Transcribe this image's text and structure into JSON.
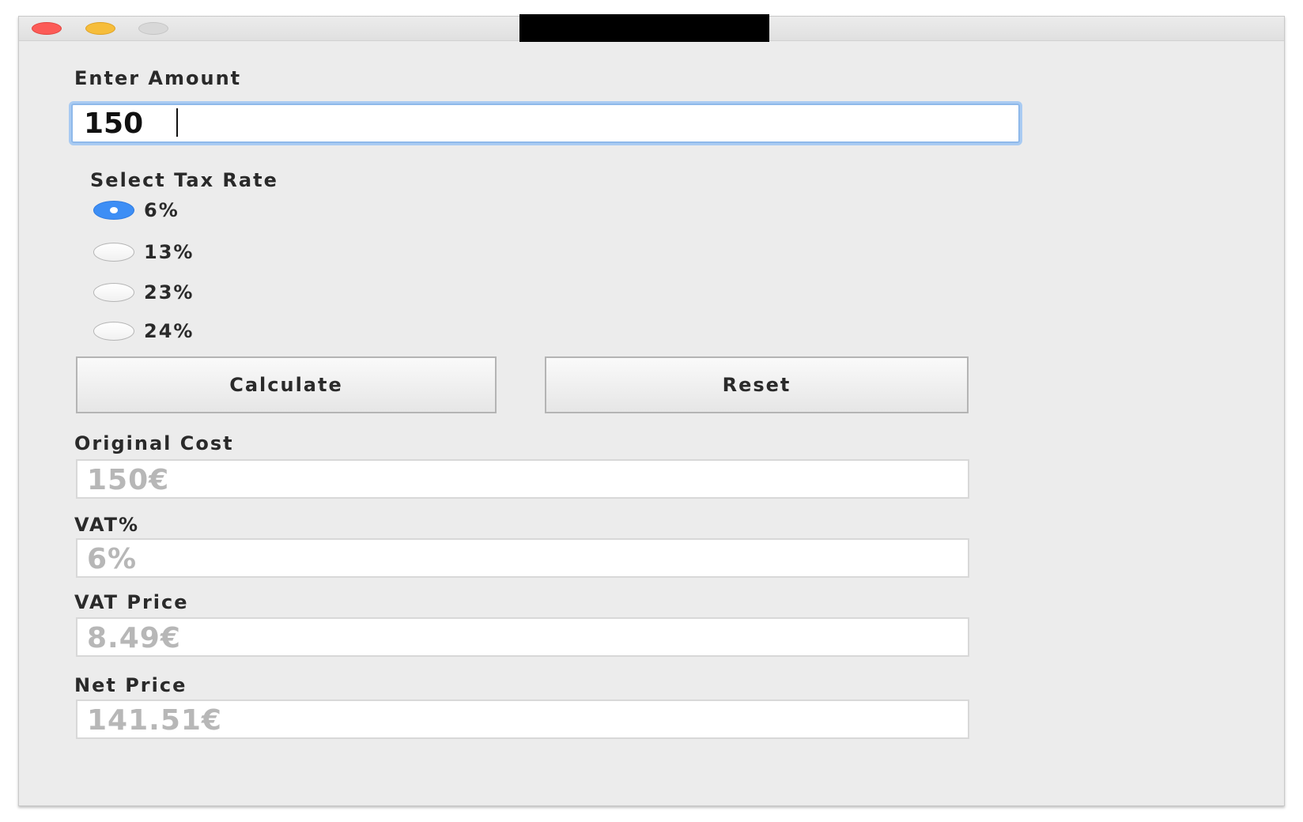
{
  "window": {
    "title": "",
    "controls": {
      "close_icon": "close-traffic-light",
      "minimize_icon": "minimize-traffic-light",
      "maximize_icon": "maximize-traffic-light"
    },
    "colors": {
      "close": "#fc5b57",
      "minimize": "#f6bd3b",
      "maximize": "#d8d8d8",
      "focus_ring": "#8fb9ea",
      "radio_selected": "#3d8ef5"
    }
  },
  "amount": {
    "label": "Enter Amount",
    "value": "150"
  },
  "tax": {
    "label": "Select Tax Rate",
    "options": [
      "6%",
      "13%",
      "23%",
      "24%"
    ],
    "selected": "6%"
  },
  "buttons": {
    "calculate": "Calculate",
    "reset": "Reset"
  },
  "results": {
    "original_cost": {
      "label": "Original Cost",
      "value": "150€"
    },
    "vat_percent": {
      "label": "VAT%",
      "value": "6%"
    },
    "vat_price": {
      "label": "VAT Price",
      "value": "8.49€"
    },
    "net_price": {
      "label": "Net Price",
      "value": "141.51€"
    }
  }
}
